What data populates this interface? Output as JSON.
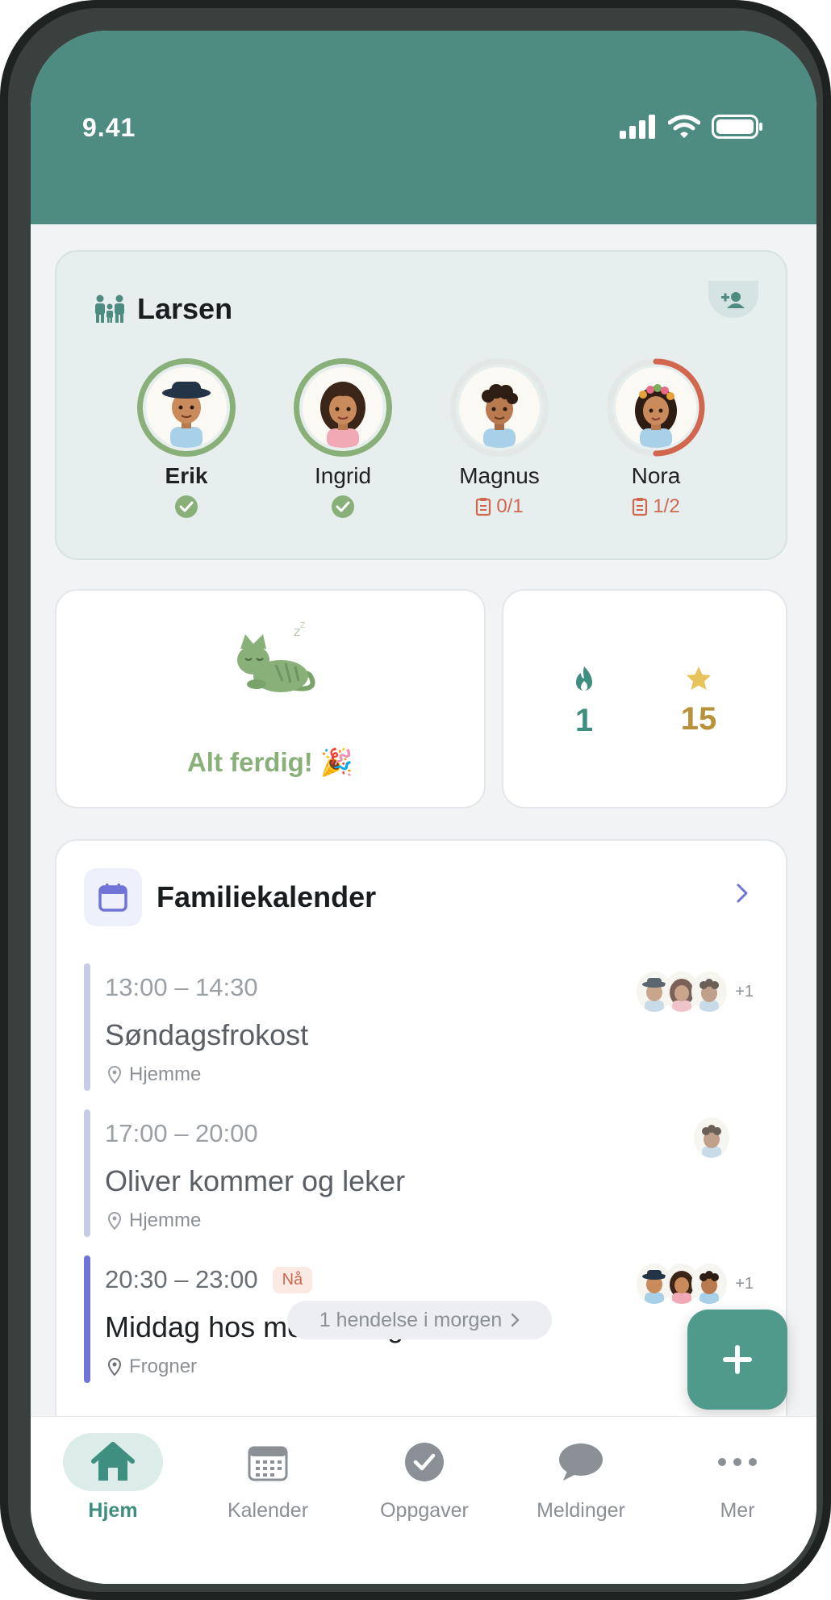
{
  "status_bar": {
    "time": "9.41"
  },
  "family": {
    "name": "Larsen",
    "members": [
      {
        "name": "Erik",
        "status": "done",
        "progress": 1.0,
        "task_count": ""
      },
      {
        "name": "Ingrid",
        "status": "done",
        "progress": 1.0,
        "task_count": ""
      },
      {
        "name": "Magnus",
        "status": "pending",
        "progress": 0.0,
        "task_count": "0/1"
      },
      {
        "name": "Nora",
        "status": "pending",
        "progress": 0.5,
        "task_count": "1/2"
      }
    ]
  },
  "done_card": {
    "text": "Alt ferdig! 🎉"
  },
  "stats": {
    "streak": "1",
    "stars": "15"
  },
  "calendar": {
    "title": "Familiekalender",
    "events": [
      {
        "time": "13:00 – 14:30",
        "title": "Søndagsfrokost",
        "location": "Hjemme",
        "now": false,
        "extra": "+1"
      },
      {
        "time": "17:00 – 20:00",
        "title": "Oliver kommer og leker",
        "location": "Hjemme",
        "now": false,
        "extra": ""
      },
      {
        "time": "20:30 – 23:00",
        "title": "Middag hos mormor og morfar",
        "location": "Frogner",
        "now": true,
        "now_label": "Nå",
        "extra": "+1"
      }
    ],
    "tomorrow": "1 hendelse i morgen"
  },
  "tabs": [
    {
      "label": "Hjem",
      "icon": "home-icon",
      "active": true
    },
    {
      "label": "Kalender",
      "icon": "calendar-icon",
      "active": false
    },
    {
      "label": "Oppgaver",
      "icon": "checkmark-icon",
      "active": false
    },
    {
      "label": "Meldinger",
      "icon": "chat-icon",
      "active": false
    },
    {
      "label": "Mer",
      "icon": "more-icon",
      "active": false
    }
  ],
  "colors": {
    "accent": "#4e8c82",
    "done_green": "#8ab07a",
    "warning": "#d2674f",
    "calendar_purple": "#6f74d6",
    "star_gold": "#b8913a"
  }
}
